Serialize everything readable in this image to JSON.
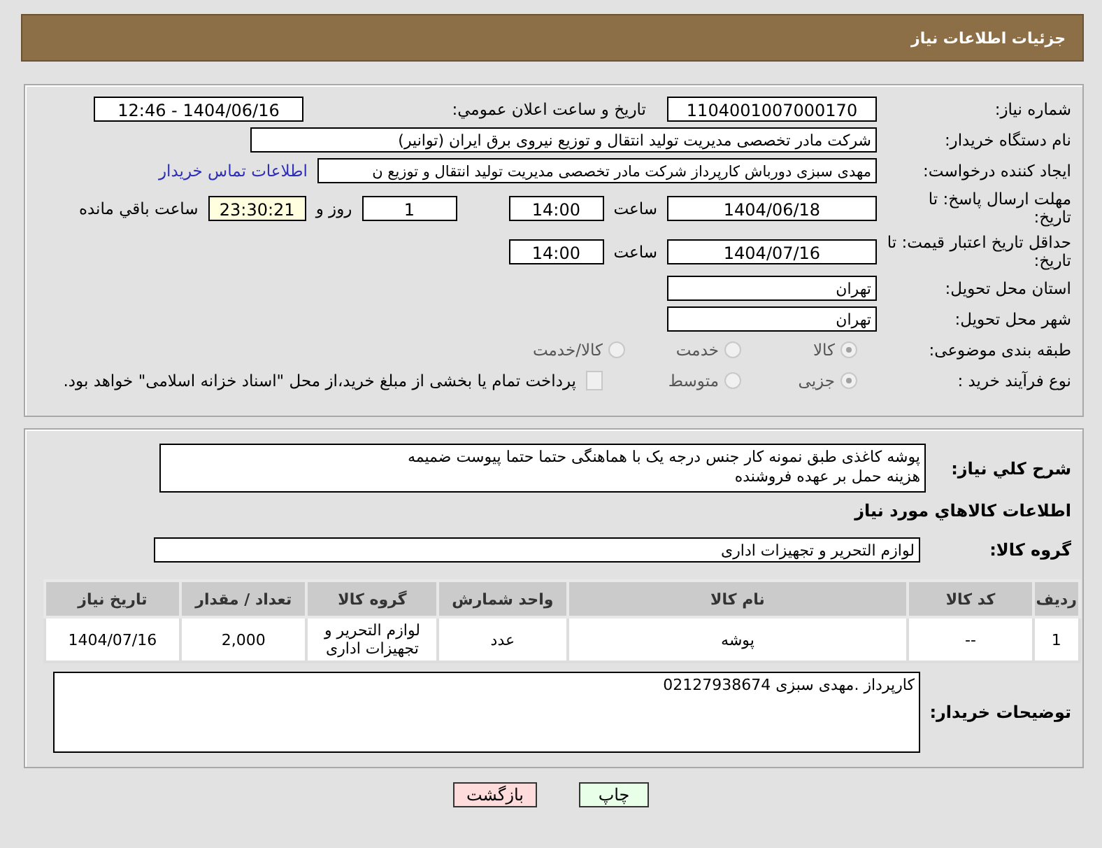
{
  "header": {
    "title": "جزئیات اطلاعات نیاز"
  },
  "need_number": {
    "label": "شماره نیاز:",
    "value": "1104001007000170"
  },
  "announce": {
    "label": "تاریخ و ساعت اعلان عمومي:",
    "value": "1404/06/16 - 12:46"
  },
  "buyer": {
    "label": "نام دستگاه خریدار:",
    "value": "شرکت مادر تخصصی مدیریت تولید  انتقال و توزیع نیروی برق ایران (توانیر)"
  },
  "creator": {
    "label": "ایجاد کننده درخواست:",
    "value": "مهدی سبزی دورباش کارپرداز شرکت مادر تخصصی مدیریت تولید  انتقال و توزیع ن",
    "link": "اطلاعات تماس خریدار"
  },
  "deadline": {
    "label": "مهلت ارسال پاسخ: تا تاریخ:",
    "date": "1404/06/18",
    "time_label": "ساعت",
    "time": "14:00",
    "days": "1",
    "days_label": "روز و",
    "remaining": "23:30:21",
    "remaining_label": "ساعت باقي مانده"
  },
  "validity": {
    "label": "حداقل تاریخ اعتبار قیمت: تا تاریخ:",
    "date": "1404/07/16",
    "time_label": "ساعت",
    "time": "14:00"
  },
  "province": {
    "label": "استان محل تحویل:",
    "value": "تهران"
  },
  "city": {
    "label": "شهر محل تحویل:",
    "value": "تهران"
  },
  "category": {
    "label": "طبقه بندی موضوعی:",
    "options": [
      {
        "label": "کالا",
        "selected": true
      },
      {
        "label": "خدمت",
        "selected": false
      },
      {
        "label": "کالا/خدمت",
        "selected": false
      }
    ]
  },
  "process": {
    "label": "نوع فرآیند خرید :",
    "options": [
      {
        "label": "جزیی",
        "selected": true
      },
      {
        "label": "متوسط",
        "selected": false
      }
    ],
    "treasury": {
      "checked": false,
      "label": "پرداخت تمام یا بخشی از مبلغ خرید،از محل \"اسناد خزانه اسلامی\" خواهد بود."
    }
  },
  "summary": {
    "label": "شرح کلي نیاز:",
    "lines": [
      "پوشه کاغذی طبق نمونه کار جنس درجه یک با هماهنگی حتما حتما پیوست ضمیمه",
      "هزینه حمل بر عهده فروشنده"
    ]
  },
  "goods_heading": "اطلاعات کالاهاي مورد نیاز",
  "goods_group": {
    "label": "گروه کالا:",
    "value": "لوازم التحریر و تجهیزات اداری"
  },
  "table": {
    "columns": [
      "ردیف",
      "کد کالا",
      "نام کالا",
      "واحد شمارش",
      "گروه کالا",
      "تعداد / مقدار",
      "تاریخ نیاز"
    ],
    "rows": [
      [
        "1",
        "--",
        "پوشه",
        "عدد",
        "لوازم التحریر و تجهیزات اداری",
        "2,000",
        "1404/07/16"
      ]
    ]
  },
  "buyer_notes": {
    "label": "توضیحات خریدار:",
    "value": "کارپرداز .مهدی سبزی 02127938674"
  },
  "buttons": [
    {
      "label": "چاپ",
      "kind": "print"
    },
    {
      "label": "بازگشت",
      "kind": "back"
    }
  ]
}
